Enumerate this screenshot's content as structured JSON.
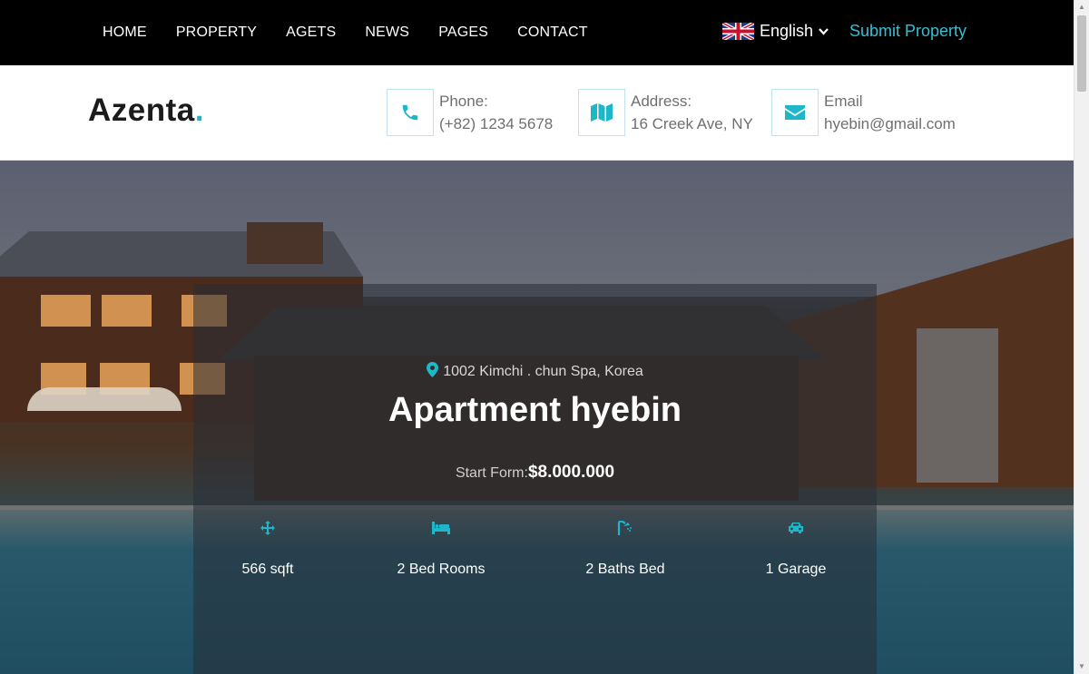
{
  "nav": {
    "items": [
      "HOME",
      "PROPERTY",
      "AGETS",
      "NEWS",
      "PAGES",
      "CONTACT"
    ],
    "language": "English",
    "submit_label": "Submit Property"
  },
  "header": {
    "logo_text": "Azenta",
    "logo_dot": ".",
    "phone_label": "Phone:",
    "phone_value": "(+82) 1234 5678",
    "address_label": "Address:",
    "address_value": "16 Creek Ave, NY",
    "email_label": "Email",
    "email_value": "hyebin@gmail.com"
  },
  "hero": {
    "location": "1002 Kimchi . chun Spa, Korea",
    "title": "Apartment hyebin",
    "price_prefix": "Start Form:",
    "price_value": "$8.000.000",
    "features": [
      {
        "icon": "arrows-icon",
        "label": "566 sqft"
      },
      {
        "icon": "bed-icon",
        "label": "2 Bed Rooms"
      },
      {
        "icon": "bath-icon",
        "label": "2 Baths Bed"
      },
      {
        "icon": "car-icon",
        "label": "1 Garage"
      }
    ]
  },
  "colors": {
    "accent": "#33c0d6",
    "topbar": "#000000",
    "icon_teal": "#1eb6c9"
  }
}
